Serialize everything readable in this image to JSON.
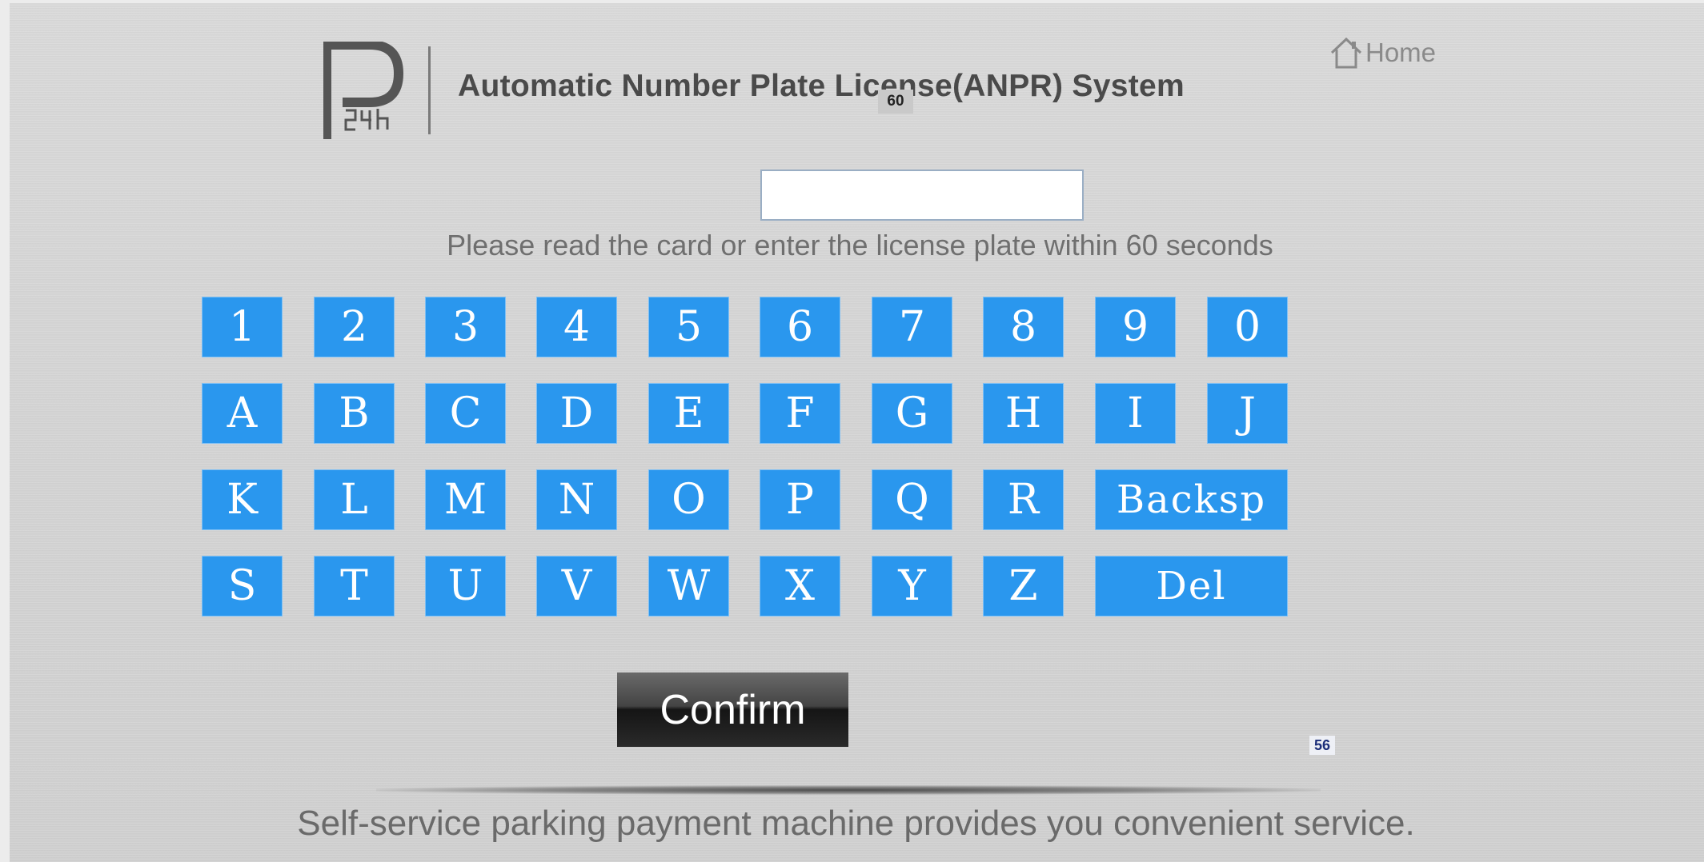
{
  "header": {
    "logo_text": "P24h",
    "title": "Automatic Number Plate License(ANPR) System",
    "badge": "60",
    "home_label": "Home"
  },
  "plate_input": {
    "value": "",
    "placeholder": ""
  },
  "prompt": "Please read the card or enter the license plate within 60 seconds",
  "keypad": {
    "rows": [
      [
        "1",
        "2",
        "3",
        "4",
        "5",
        "6",
        "7",
        "8",
        "9",
        "0"
      ],
      [
        "A",
        "B",
        "C",
        "D",
        "E",
        "F",
        "G",
        "H",
        "I",
        "J"
      ],
      [
        "K",
        "L",
        "M",
        "N",
        "O",
        "P",
        "Q",
        "R",
        "Backsp"
      ],
      [
        "S",
        "T",
        "U",
        "V",
        "W",
        "X",
        "Y",
        "Z",
        "Del"
      ]
    ]
  },
  "confirm_label": "Confirm",
  "counter": "56",
  "footer": "Self-service parking payment machine provides you convenient service.",
  "colors": {
    "key_bg": "#2a97ee",
    "key_text": "#ffffff",
    "title": "#4a4a4a"
  }
}
